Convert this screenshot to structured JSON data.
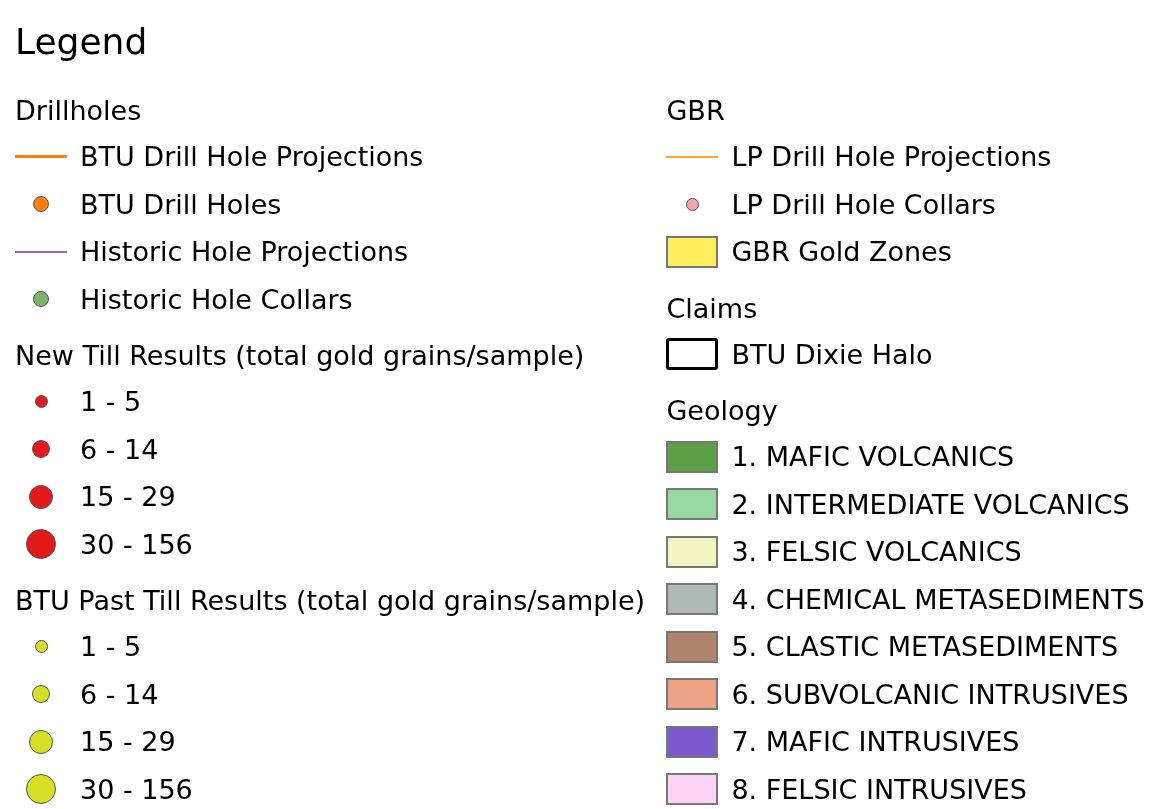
{
  "title": "Legend",
  "columns": [
    {
      "groups": [
        {
          "heading": "Drillholes",
          "items": [
            {
              "kind": "thickline",
              "color": "#ff7f0e",
              "label": "BTU Drill Hole Projections"
            },
            {
              "kind": "dotsmall",
              "color": "#ff7f0e",
              "label": "BTU Drill Holes"
            },
            {
              "kind": "thinline",
              "color": "#9b6bae",
              "label": "Historic Hole Projections"
            },
            {
              "kind": "dotsmall",
              "color": "#7db36a",
              "label": "Historic Hole Collars"
            }
          ]
        },
        {
          "heading": "New Till Results (total gold grains/sample)",
          "items": [
            {
              "kind": "dotxsmall",
              "color": "#e31a1c",
              "label": "1 - 5"
            },
            {
              "kind": "dotmedium",
              "color": "#e31a1c",
              "label": "6 - 14"
            },
            {
              "kind": "dotlarge",
              "color": "#e31a1c",
              "label": "15 - 29"
            },
            {
              "kind": "dotxlarge",
              "color": "#e31a1c",
              "label": "30 - 156"
            }
          ]
        },
        {
          "heading": "BTU Past Till Results (total gold grains/sample)",
          "items": [
            {
              "kind": "dotxsmall",
              "color": "#d6df24",
              "label": "1 - 5"
            },
            {
              "kind": "dotmedium",
              "color": "#d6df24",
              "label": "6 - 14"
            },
            {
              "kind": "dotlarge",
              "color": "#d6df24",
              "label": "15 - 29"
            },
            {
              "kind": "dotxlarge",
              "color": "#d6df24",
              "label": "30 - 156"
            }
          ]
        }
      ]
    },
    {
      "groups": [
        {
          "heading": "GBR",
          "items": [
            {
              "kind": "thinline",
              "color": "#ffa526",
              "label": "LP Drill Hole Projections"
            },
            {
              "kind": "dotxsmall",
              "color": "#f4a3b0",
              "label": "LP Drill Hole Collars"
            },
            {
              "kind": "fill",
              "color": "#ffef5c",
              "label": "GBR Gold Zones"
            }
          ]
        },
        {
          "heading": "Claims",
          "items": [
            {
              "kind": "outline",
              "color": "#000000",
              "label": "BTU Dixie Halo"
            }
          ]
        },
        {
          "heading": "Geology",
          "items": [
            {
              "kind": "fill",
              "color": "#5aa047",
              "label": "1. MAFIC VOLCANICS"
            },
            {
              "kind": "fill",
              "color": "#96d8a2",
              "label": "2. INTERMEDIATE VOLCANICS"
            },
            {
              "kind": "fill",
              "color": "#f2f5c0",
              "label": "3. FELSIC VOLCANICS"
            },
            {
              "kind": "fill",
              "color": "#afbab6",
              "label": "4. CHEMICAL METASEDIMENTS"
            },
            {
              "kind": "fill",
              "color": "#b0846c",
              "label": "5. CLASTIC METASEDIMENTS"
            },
            {
              "kind": "fill",
              "color": "#eda383",
              "label": "6. SUBVOLCANIC INTRUSIVES"
            },
            {
              "kind": "fill",
              "color": "#7b59cc",
              "label": "7. MAFIC INTRUSIVES"
            },
            {
              "kind": "fill",
              "color": "#fdd3f6",
              "label": "8. FELSIC INTRUSIVES"
            }
          ]
        }
      ]
    }
  ]
}
